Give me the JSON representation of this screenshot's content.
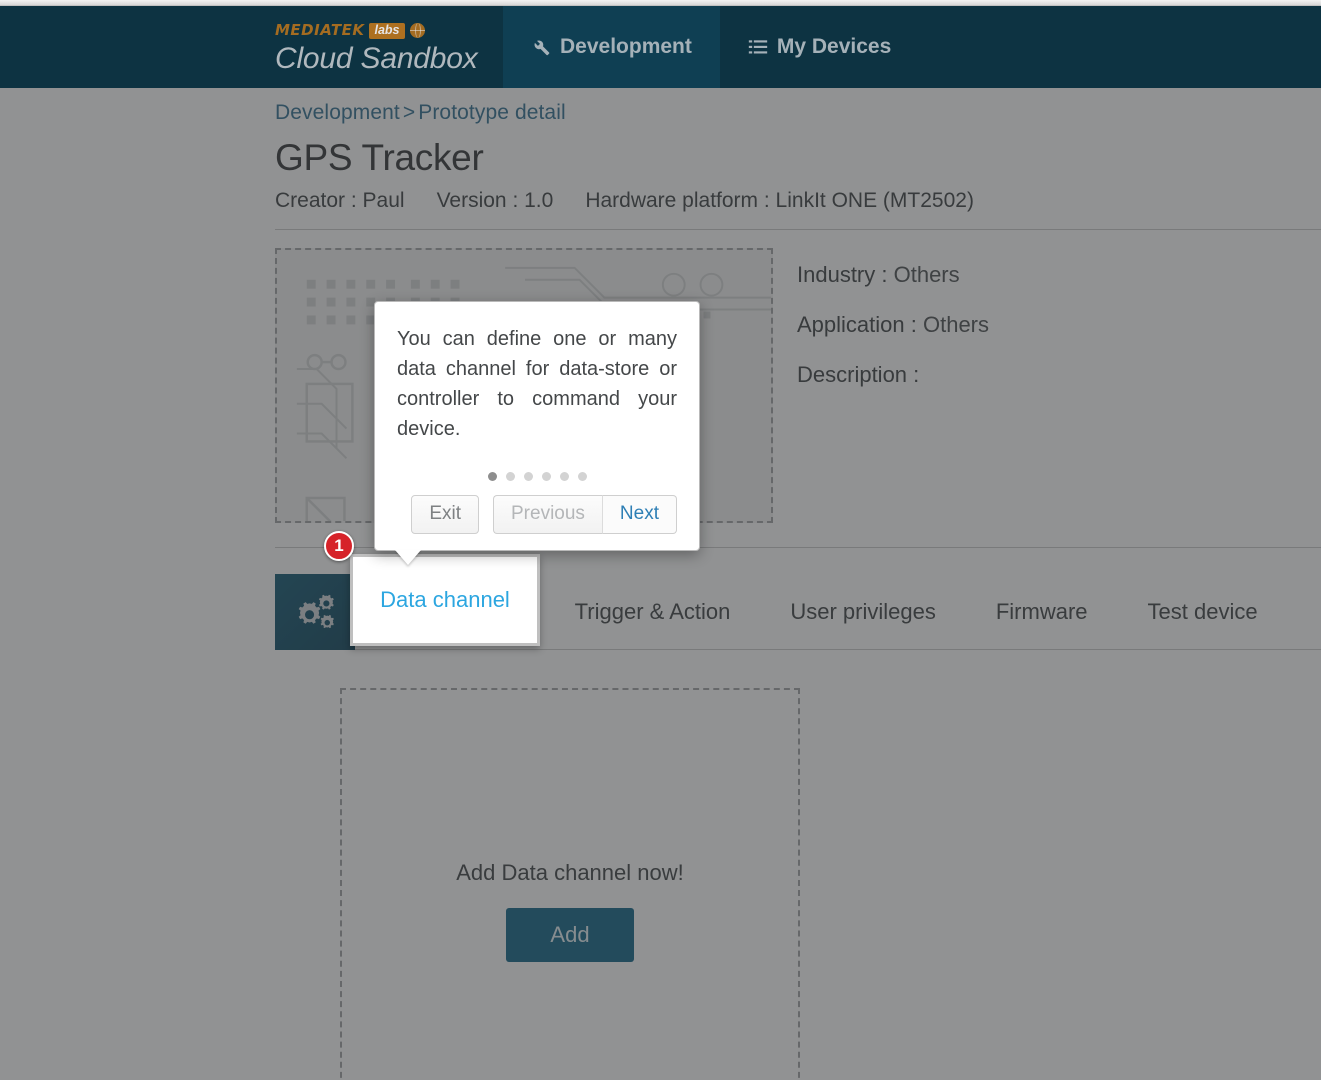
{
  "brand": {
    "mediatek": "MEDIATEK",
    "labs": "labs",
    "product": "Cloud Sandbox"
  },
  "topnav": {
    "items": [
      {
        "label": "Development",
        "icon": "wrench-icon",
        "active": true
      },
      {
        "label": "My Devices",
        "icon": "list-icon",
        "active": false
      }
    ]
  },
  "breadcrumb": {
    "parent": "Development",
    "separator": ">",
    "current": "Prototype detail"
  },
  "prototype": {
    "title": "GPS Tracker",
    "meta": [
      "Creator : Paul",
      "Version : 1.0",
      "Hardware platform : LinkIt ONE (MT2502)"
    ],
    "info": [
      {
        "label": "Industry :",
        "value": "Others"
      },
      {
        "label": "Application :",
        "value": "Others"
      },
      {
        "label": "Description :",
        "value": ""
      }
    ]
  },
  "tabs": [
    {
      "label": "Data channel",
      "active": true
    },
    {
      "label": "Trigger & Action",
      "active": false
    },
    {
      "label": "User privileges",
      "active": false
    },
    {
      "label": "Firmware",
      "active": false
    },
    {
      "label": "Test device",
      "active": false
    }
  ],
  "data_channel_panel": {
    "empty_text": "Add Data channel now!",
    "add_button": "Add"
  },
  "tour": {
    "step_badge": "1",
    "body": "You can define one or many data channel for data-store or controller to command your device.",
    "dots_total": 6,
    "dots_active_index": 0,
    "buttons": {
      "exit": "Exit",
      "previous": "Previous",
      "next": "Next"
    },
    "highlighted_tab": "Data channel"
  },
  "colors": {
    "nav_background": "#0a3545",
    "nav_active": "#0c4258",
    "brand_orange": "#b5761f",
    "link_blue": "#2d6e91",
    "accent_cyan": "#2ca6e0",
    "button_teal": "#0d6285",
    "badge_red": "#d6232a",
    "dim_overlay": "#37393b"
  }
}
